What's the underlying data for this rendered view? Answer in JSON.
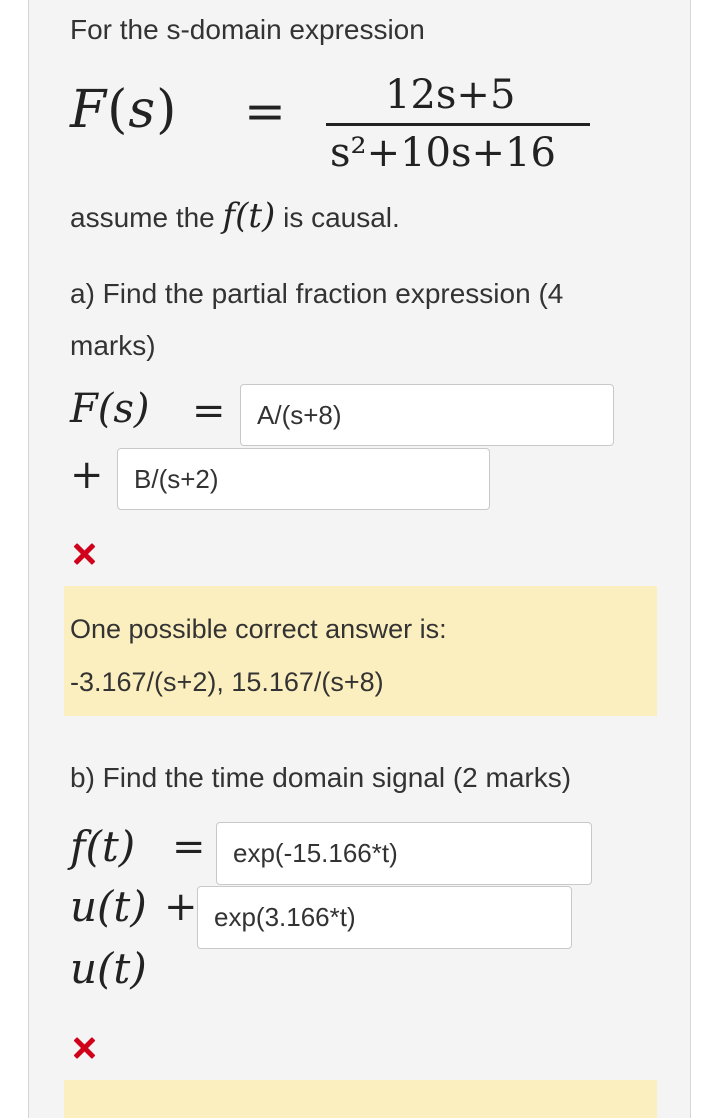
{
  "question": {
    "intro": "For the s-domain expression",
    "formula": {
      "lhs_func": "F",
      "lhs_arg": "s",
      "equals": "=",
      "numerator": "12s+5",
      "denominator": "s²+10s+16"
    },
    "causal_prefix": "assume the",
    "causal_func": "f(t)",
    "causal_suffix": "is causal."
  },
  "part_a": {
    "label": "a) Find the partial fraction  expression (4 marks)",
    "lhs": "F(s)",
    "equals": "=",
    "plus": "+",
    "input_a_value": "A/(s+8)",
    "input_b_value": "B/(s+2)",
    "status": "incorrect",
    "feedback_title": "One possible correct answer is:",
    "feedback_answer": "-3.167/(s+2), 15.167/(s+8)"
  },
  "part_b": {
    "label": "b) Find the time domain signal (2 marks)",
    "lhs": "f(t)",
    "equals": "=",
    "unit_step_1": "u(t)",
    "plus": "+",
    "unit_step_2": "u(t)",
    "input_c_value": "exp(-15.166*t)",
    "input_d_value": "exp(3.166*t)",
    "status": "incorrect"
  },
  "colors": {
    "panel_bg": "#f4f4f4",
    "feedback_bg": "#fcefbf",
    "incorrect_mark": "#d0011b"
  }
}
